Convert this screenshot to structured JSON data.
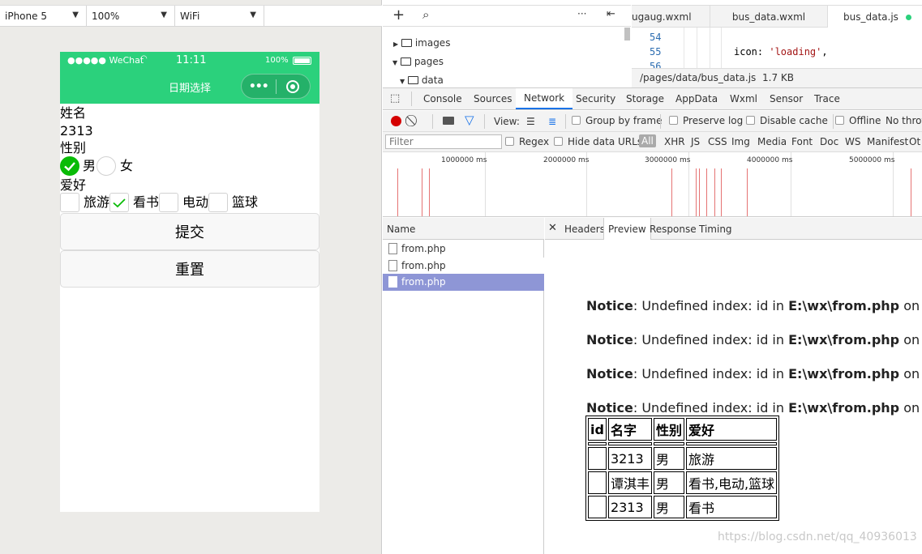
{
  "simulator": {
    "device": "iPhone 5",
    "zoom": "100%",
    "network": "WiFi",
    "status": {
      "carrier": "●●●●● WeChat",
      "time": "11:11",
      "battery": "100%"
    },
    "nav_title": "日期选择",
    "form": {
      "name_label": "姓名",
      "name_value": "2313",
      "gender_label": "性别",
      "gender_options": [
        "男",
        "女"
      ],
      "gender_selected": "男",
      "hobby_label": "爱好",
      "hobbies": [
        "旅游",
        "看书",
        "电动",
        "篮球"
      ],
      "hobbies_checked": [
        "看书"
      ],
      "submit": "提交",
      "reset": "重置"
    }
  },
  "editor": {
    "tabs": [
      "ugaug.wxml",
      "bus_data.wxml",
      "bus_data.js"
    ],
    "active_tab": "bus_data.js",
    "tree": [
      "images",
      "pages",
      "data"
    ],
    "lines": [
      {
        "num": "54",
        "code": ""
      },
      {
        "num": "55",
        "code": "icon: 'loading',"
      },
      {
        "num": "56",
        "code": ""
      }
    ],
    "file_path": "/pages/data/bus_data.js",
    "file_size": "1.7 KB"
  },
  "devtools": {
    "tabs": [
      "Console",
      "Sources",
      "Network",
      "Security",
      "Storage",
      "AppData",
      "Wxml",
      "Sensor",
      "Trace"
    ],
    "active_tab": "Network",
    "toolbar": {
      "view_label": "View:",
      "group_by_frame": "Group by frame",
      "preserve_log": "Preserve log",
      "disable_cache": "Disable cache",
      "offline": "Offline",
      "throttle": "No throt"
    },
    "filter_placeholder": "Filter",
    "filter_types": [
      "Regex",
      "Hide data URLs",
      "All",
      "XHR",
      "JS",
      "CSS",
      "Img",
      "Media",
      "Font",
      "Doc",
      "WS",
      "Manifest",
      "Ot"
    ],
    "timeline_ticks": [
      "1000000 ms",
      "2000000 ms",
      "3000000 ms",
      "4000000 ms",
      "5000000 ms"
    ],
    "name_header": "Name",
    "requests": [
      "from.php",
      "from.php",
      "from.php"
    ],
    "selected_request_index": 2,
    "detail_tabs": [
      "Headers",
      "Preview",
      "Response",
      "Timing"
    ],
    "active_detail_tab": "Preview",
    "notices": [
      {
        "label": "Notice",
        "text": ": Undefined index: id in ",
        "path": "E:\\wx\\from.php",
        "tail": " on line"
      },
      {
        "label": "Notice",
        "text": ": Undefined index: id in ",
        "path": "E:\\wx\\from.php",
        "tail": " on line"
      },
      {
        "label": "Notice",
        "text": ": Undefined index: id in ",
        "path": "E:\\wx\\from.php",
        "tail": " on line"
      },
      {
        "label": "Notice",
        "text": ": Undefined index: id in ",
        "path": "E:\\wx\\from.php",
        "tail": " on line"
      }
    ],
    "table": {
      "headers": [
        "id",
        "名字",
        "性别",
        "爱好"
      ],
      "rows": [
        [
          "",
          "",
          "",
          ""
        ],
        [
          "",
          "3213",
          "男",
          "旅游"
        ],
        [
          "",
          "谭淇丰",
          "男",
          "看书,电动,篮球"
        ],
        [
          "",
          "2313",
          "男",
          "看书"
        ]
      ]
    }
  },
  "watermark": "https://blog.csdn.net/qq_40936013",
  "colors": {
    "wechat_green": "#2bd17c",
    "radio_green": "#09bb07",
    "selected_row": "#8e96d6",
    "record_red": "#d50000",
    "network_blue": "#1a73e8"
  }
}
